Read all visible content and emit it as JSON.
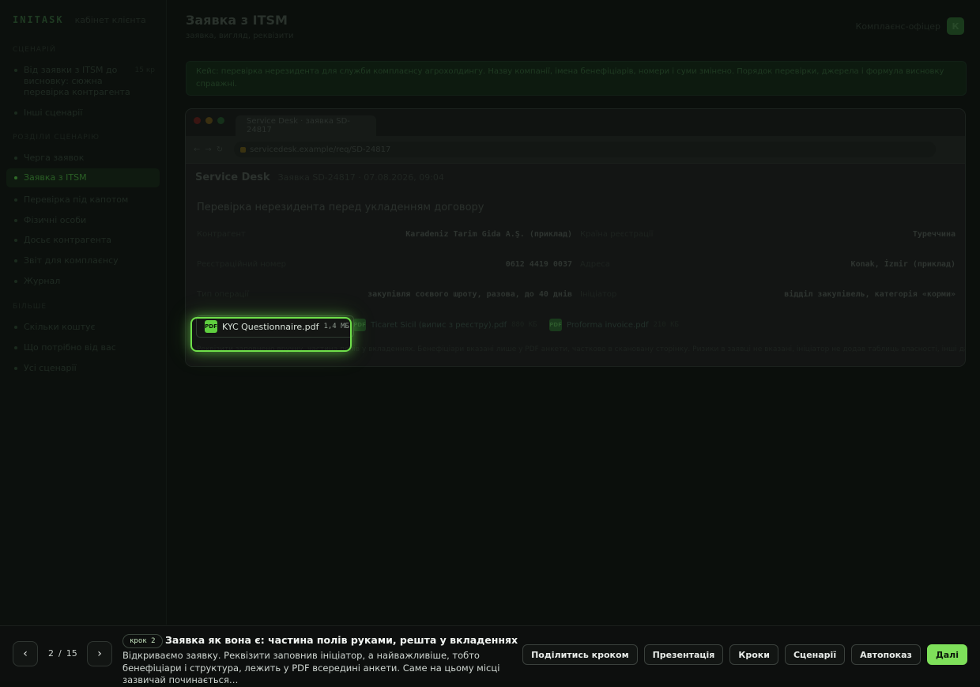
{
  "sidebar": {
    "logo": "INITASK",
    "subtitle": "кабінет клієнта",
    "sections": [
      {
        "title": "сценарій",
        "items": [
          {
            "label": "Від заявки з ITSM до висновку: сюжна перевірка контрагента",
            "count": "15 кр"
          },
          {
            "label": "Інші сценарії",
            "count": ""
          }
        ]
      },
      {
        "title": "розділи сценарію",
        "items": [
          {
            "label": "Черга заявок"
          },
          {
            "label": "Заявка з ITSM",
            "active": true
          },
          {
            "label": "Перевірка під капотом"
          },
          {
            "label": "Фізичні особи"
          },
          {
            "label": "Досьє контрагента"
          },
          {
            "label": "Звіт для комплаєнсу"
          },
          {
            "label": "Журнал"
          }
        ]
      },
      {
        "title": "більше",
        "items": [
          {
            "label": "Скільки коштує"
          },
          {
            "label": "Що потрібно від вас"
          },
          {
            "label": "Усі сценарії"
          }
        ]
      }
    ]
  },
  "header": {
    "title": "Заявка з ITSM",
    "subtitle": "заявка, вигляд, реквізити",
    "user_name": "Комплаєнс-офіцер",
    "avatar_letter": "К"
  },
  "banner": {
    "text": "Кейс: перевірка нерезидента для служби комплаєнсу агрохолдингу. Назву компанії, імена бенефіціарів, номери і суми змінено. Порядок перевірки, джерела і формула висновку справжні."
  },
  "browser": {
    "tab_title": "Service Desk · заявка SD-24817",
    "url": "servicedesk.example/req/SD-24817",
    "app_name": "Service Desk",
    "request_meta": "Заявка SD-24817 · 07.08.2026, 09:04",
    "heading": "Перевірка нерезидента перед укладенням договору",
    "fields": [
      {
        "k": "Контрагент",
        "v": "Karadeniz Tarim Gida A.Ş. (приклад)",
        "k2": "Країна реєстрації",
        "v2": "Туреччина"
      },
      {
        "k": "Реєстраційний номер",
        "v": "0612 4419 0037",
        "k2": "Адреса",
        "v2": "Konak, İzmir (приклад)"
      },
      {
        "k": "Тип операції",
        "v": "закупівля соєвого шроту, разова, до 40 днів",
        "k2": "Ініціатор",
        "v2": "відділ закупівель, категорія «корми»"
      }
    ],
    "attachments": [
      {
        "name": "KYC Questionnaire.pdf",
        "size": "1,4 МБ",
        "icon": "PDF"
      },
      {
        "name": "Ticaret Sicil (випис з реєстру).pdf",
        "size": "880 КБ",
        "icon": "PDF"
      },
      {
        "name": "Proforma invoice.pdf",
        "size": "210 КБ",
        "icon": "PDF"
      }
    ],
    "note": "Реквізити заповнено вручну, частина полів у вкладеннях. Бенефіціари вказані лише у PDF анкети, частково в скановану сторінку. Ризики в заявці не вказані, ініціатор не додав таблиць власності, інші дані вручну."
  },
  "tour": {
    "current": "2",
    "total": "15",
    "step_badge": "крок 2",
    "step_title": "Заявка як вона є: частина полів руками, решта у вкладеннях",
    "step_desc": "Відкриваємо заявку. Реквізити заповнив ініціатор, а найважливіше, тобто бенефіціари і структура, лежить у PDF всередині анкети. Саме на цьому місці зазвичай починається…",
    "actions": [
      "Поділитись кроком",
      "Презентація",
      "Кроки",
      "Сценарії",
      "Автопоказ",
      "Далі"
    ],
    "prev": "‹",
    "next": "›",
    "sep": "/"
  },
  "colors": {
    "accent": "#7ee05a",
    "highlight": "#6fe04a"
  }
}
